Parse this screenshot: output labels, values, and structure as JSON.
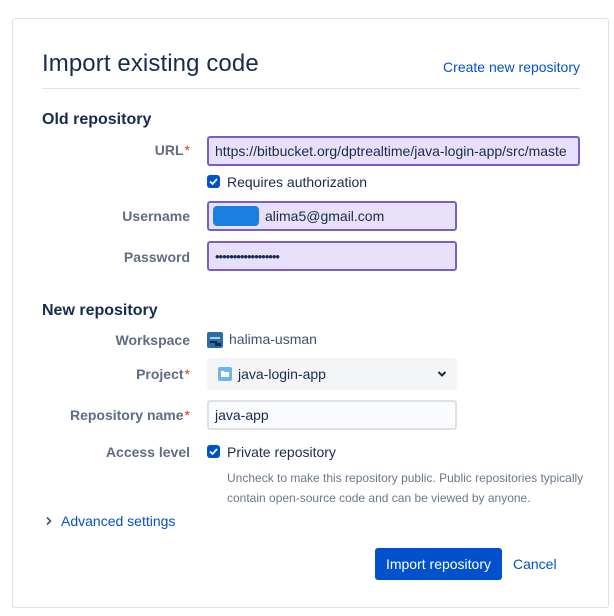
{
  "header": {
    "title": "Import existing code",
    "create_link": "Create new repository"
  },
  "old_repo": {
    "section_title": "Old repository",
    "url_label": "URL",
    "url_value": "https://bitbucket.org/dptrealtime/java-login-app/src/maste",
    "requires_auth_label": "Requires authorization",
    "requires_auth_checked": true,
    "username_label": "Username",
    "username_value": "alima5@gmail.com",
    "password_label": "Password",
    "password_value": "••••••••••••••••••"
  },
  "new_repo": {
    "section_title": "New repository",
    "workspace_label": "Workspace",
    "workspace_value": "halima-usman",
    "project_label": "Project",
    "project_value": "java-login-app",
    "repo_name_label": "Repository name",
    "repo_name_value": "java-app",
    "access_label": "Access level",
    "private_label": "Private repository",
    "private_checked": true,
    "help_text": "Uncheck to make this repository public. Public repositories typically contain open-source code and can be viewed by anyone."
  },
  "advanced": {
    "label": "Advanced settings"
  },
  "actions": {
    "import_label": "Import repository",
    "cancel_label": "Cancel"
  },
  "colors": {
    "accent": "#0052cc",
    "input_focus_bg": "#e8e0fb",
    "input_focus_border": "#7a5dc7",
    "required": "#de350b"
  },
  "icons": {
    "checkbox": "checkmark-icon",
    "workspace": "workspace-avatar-icon",
    "project": "folder-icon",
    "select": "chevron-down-icon",
    "advanced": "chevron-right-icon"
  }
}
